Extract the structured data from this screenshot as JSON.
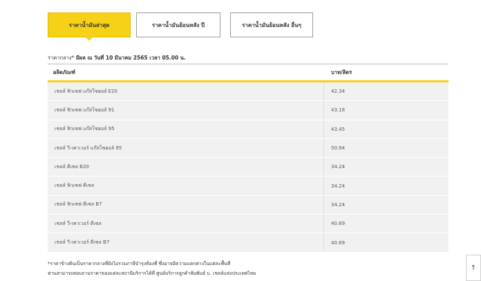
{
  "tabs": [
    {
      "label": "ราคาน้ำมันล่าสุด"
    },
    {
      "label": "ราคาน้ำมันย้อนหลัง ปี"
    },
    {
      "label": "ราคาน้ำมันย้อนหลัง อื่นๆ"
    }
  ],
  "notice": {
    "lead": "ราคากลาง*",
    "text": "มีผล ณ วันที่ 10 มีนาคม 2565 เวลา 05.00 น."
  },
  "table": {
    "headers": [
      "ผลิตภัณฑ์",
      "บาท/ลิตร"
    ],
    "rows": [
      {
        "product": "เชลล์ ฟิวเซฟ แก๊สโซฮอล์ E20",
        "price": "42.34"
      },
      {
        "product": "เชลล์ ฟิวเซฟ แก๊สโซฮอล์ 91",
        "price": "43.18"
      },
      {
        "product": "เชลล์ ฟิวเซฟ แก๊สโซฮอล์ 95",
        "price": "43.45"
      },
      {
        "product": "เชลล์ วี-เพาเวอร์ แก๊สโซฮอล์ 95",
        "price": "50.94"
      },
      {
        "product": "เชลล์ ดีเซล B20",
        "price": "34.24"
      },
      {
        "product": "เชลล์ ฟิวเซฟ ดีเซล",
        "price": "34.24"
      },
      {
        "product": "เชลล์ ฟิวเซฟ ดีเซล B7",
        "price": "34.24"
      },
      {
        "product": "เชลล์ วี-เพาเวอร์ ดีเซล",
        "price": "40.69"
      },
      {
        "product": "เชลล์ วี-เพาเวอร์ ดีเซล B7",
        "price": "40.69"
      }
    ]
  },
  "footer": {
    "line1": "*ราคาข้างต้นเป็นราคากลางที่ยังไม่รวมภาษีบำรุงท้องที่ ซึ่งอาจมีความแตกต่างในแต่ละพื้นที่",
    "line2": "ท่านสามารถสอบถามราคาของแต่ละสถานีบริการได้ที่ ศูนย์บริการลูกค้าสัมพันธ์ บ. เชลล์แห่งประเทศไทย"
  },
  "scroll_top": {
    "icon": "arrow-up-icon",
    "glyph": "↑"
  },
  "colors": {
    "accent": "#f7d117",
    "row_bg": "#f1f1f1"
  }
}
